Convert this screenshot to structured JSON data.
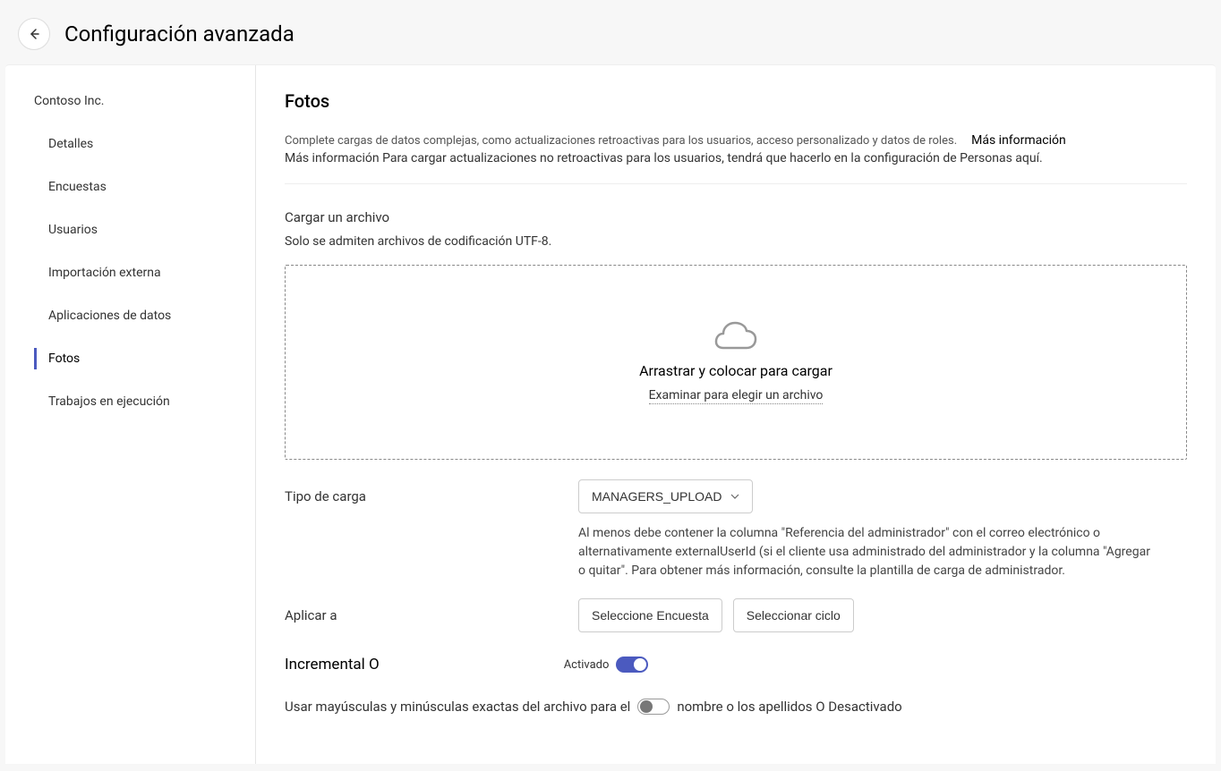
{
  "header": {
    "title": "Configuración avanzada"
  },
  "sidebar": {
    "org": "Contoso Inc.",
    "items": [
      {
        "label": "Detalles"
      },
      {
        "label": "Encuestas"
      },
      {
        "label": "Usuarios"
      },
      {
        "label": "Importación externa"
      },
      {
        "label": "Aplicaciones de datos"
      },
      {
        "label": "Fotos"
      },
      {
        "label": "Trabajos en ejecución"
      }
    ]
  },
  "main": {
    "title": "Fotos",
    "desc1": "Complete cargas de datos complejas, como actualizaciones retroactivas para los usuarios, acceso personalizado y datos de roles.",
    "more_link": "Más información",
    "desc2": "Más información Para cargar actualizaciones no retroactivas para los usuarios, tendrá que hacerlo en la configuración de Personas aquí.",
    "upload_label": "Cargar un archivo",
    "upload_hint": "Solo se admiten archivos de codificación UTF-8.",
    "dropzone_text": "Arrastrar y colocar para cargar",
    "dropzone_link": "Examinar para elegir un archivo",
    "type_label": "Tipo de carga",
    "type_value": "MANAGERS_UPLOAD",
    "type_helper": "Al menos debe contener la columna \"Referencia del administrador\" con el correo electrónico o alternativamente externalUserId (si el cliente usa administrado del administrador y la columna \"Agregar o quitar\". Para obtener más información, consulte la plantilla de carga de administrador.",
    "apply_label": "Aplicar a",
    "apply_btn1": "Seleccione Encuesta",
    "apply_btn2": "Seleccionar ciclo",
    "incremental_label": "Incremental O",
    "incremental_state": "Activado",
    "case_text_before": "Usar mayúsculas y minúsculas exactas del archivo para el",
    "case_text_mid": "nombre o los apellidos O Desactivado"
  }
}
